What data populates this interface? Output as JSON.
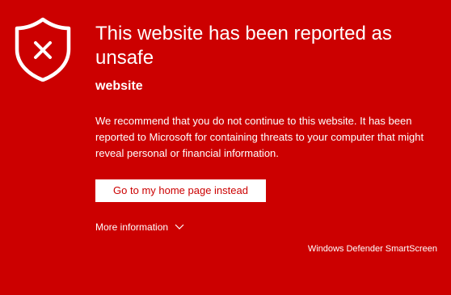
{
  "warning": {
    "title": "This website has been reported as unsafe",
    "site_name": "website",
    "message": "We recommend that you do not continue to this website. It has been reported to Microsoft for containing threats to your computer that might reveal personal or financial information.",
    "icon": "shield-x-icon"
  },
  "actions": {
    "home_button_label": "Go to my home page instead",
    "more_info_label": "More information",
    "more_info_icon": "chevron-down-icon"
  },
  "footer": {
    "brand": "Windows Defender SmartScreen"
  },
  "colors": {
    "background": "#cc0000",
    "text": "#ffffff",
    "button_bg": "#ffffff",
    "button_text": "#cc0000"
  }
}
